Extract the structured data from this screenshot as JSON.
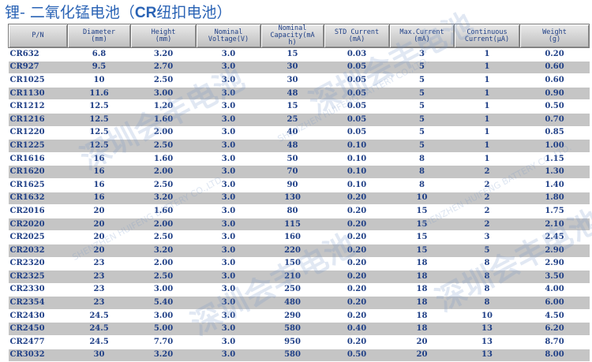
{
  "title": {
    "prefix": "锂- 二氧化锰电池（",
    "bold": "CR",
    "suffix": "纽扣电池）"
  },
  "table": {
    "headers": [
      [
        "P/N"
      ],
      [
        "Diameter",
        "(mm)"
      ],
      [
        "Height",
        "(mm)"
      ],
      [
        "Nominal",
        "Voltage(V)"
      ],
      [
        "Nominal",
        "Capacity(mA",
        "h)"
      ],
      [
        "STD Current",
        "(mA)"
      ],
      [
        "Max.Current",
        "(mA)"
      ],
      [
        "Continuous",
        "Current(μA)"
      ],
      [
        "Weight",
        "(g)"
      ]
    ],
    "rows": [
      [
        "CR632",
        "6.8",
        "3.20",
        "3.0",
        "15",
        "0.03",
        "3",
        "1",
        "0.20"
      ],
      [
        "CR927",
        "9.5",
        "2.70",
        "3.0",
        "30",
        "0.05",
        "5",
        "1",
        "0.60"
      ],
      [
        "CR1025",
        "10",
        "2.50",
        "3.0",
        "30",
        "0.05",
        "5",
        "1",
        "0.60"
      ],
      [
        "CR1130",
        "11.6",
        "3.00",
        "3.0",
        "48",
        "0.05",
        "5",
        "1",
        "0.90"
      ],
      [
        "CR1212",
        "12.5",
        "1.20",
        "3.0",
        "15",
        "0.05",
        "5",
        "1",
        "0.50"
      ],
      [
        "CR1216",
        "12.5",
        "1.60",
        "3.0",
        "25",
        "0.05",
        "5",
        "1",
        "0.70"
      ],
      [
        "CR1220",
        "12.5",
        "2.00",
        "3.0",
        "40",
        "0.05",
        "5",
        "1",
        "0.85"
      ],
      [
        "CR1225",
        "12.5",
        "2.50",
        "3.0",
        "48",
        "0.10",
        "5",
        "1",
        "1.00"
      ],
      [
        "CR1616",
        "16",
        "1.60",
        "3.0",
        "50",
        "0.10",
        "8",
        "1",
        "1.15"
      ],
      [
        "CR1620",
        "16",
        "2.00",
        "3.0",
        "70",
        "0.10",
        "8",
        "2",
        "1.30"
      ],
      [
        "CR1625",
        "16",
        "2.50",
        "3.0",
        "90",
        "0.10",
        "8",
        "2",
        "1.40"
      ],
      [
        "CR1632",
        "16",
        "3.20",
        "3.0",
        "130",
        "0.20",
        "10",
        "2",
        "1.80"
      ],
      [
        "CR2016",
        "20",
        "1.60",
        "3.0",
        "80",
        "0.20",
        "15",
        "2",
        "1.75"
      ],
      [
        "CR2020",
        "20",
        "2.00",
        "3.0",
        "115",
        "0.20",
        "15",
        "2",
        "2.10"
      ],
      [
        "CR2025",
        "20",
        "2.50",
        "3.0",
        "160",
        "0.20",
        "15",
        "3",
        "2.45"
      ],
      [
        "CR2032",
        "20",
        "3.20",
        "3.0",
        "220",
        "0.20",
        "15",
        "5",
        "2.90"
      ],
      [
        "CR2320",
        "23",
        "2.00",
        "3.0",
        "150",
        "0.20",
        "18",
        "8",
        "2.90"
      ],
      [
        "CR2325",
        "23",
        "2.50",
        "3.0",
        "210",
        "0.20",
        "18",
        "8",
        "3.50"
      ],
      [
        "CR2330",
        "23",
        "3.00",
        "3.0",
        "250",
        "0.20",
        "18",
        "8",
        "4.00"
      ],
      [
        "CR2354",
        "23",
        "5.40",
        "3.0",
        "480",
        "0.20",
        "18",
        "8",
        "6.00"
      ],
      [
        "CR2430",
        "24.5",
        "3.00",
        "3.0",
        "290",
        "0.20",
        "18",
        "10",
        "4.50"
      ],
      [
        "CR2450",
        "24.5",
        "5.00",
        "3.0",
        "580",
        "0.40",
        "18",
        "13",
        "6.20"
      ],
      [
        "CR2477",
        "24.5",
        "7.70",
        "3.0",
        "950",
        "0.20",
        "20",
        "13",
        "8.70"
      ],
      [
        "CR3032",
        "30",
        "3.20",
        "3.0",
        "580",
        "0.50",
        "20",
        "13",
        "8.00"
      ]
    ]
  },
  "watermark": {
    "chinese": "深圳会丰电池",
    "english": "SHENZHEN HUIFENG BATTERY CO.,LTD."
  }
}
